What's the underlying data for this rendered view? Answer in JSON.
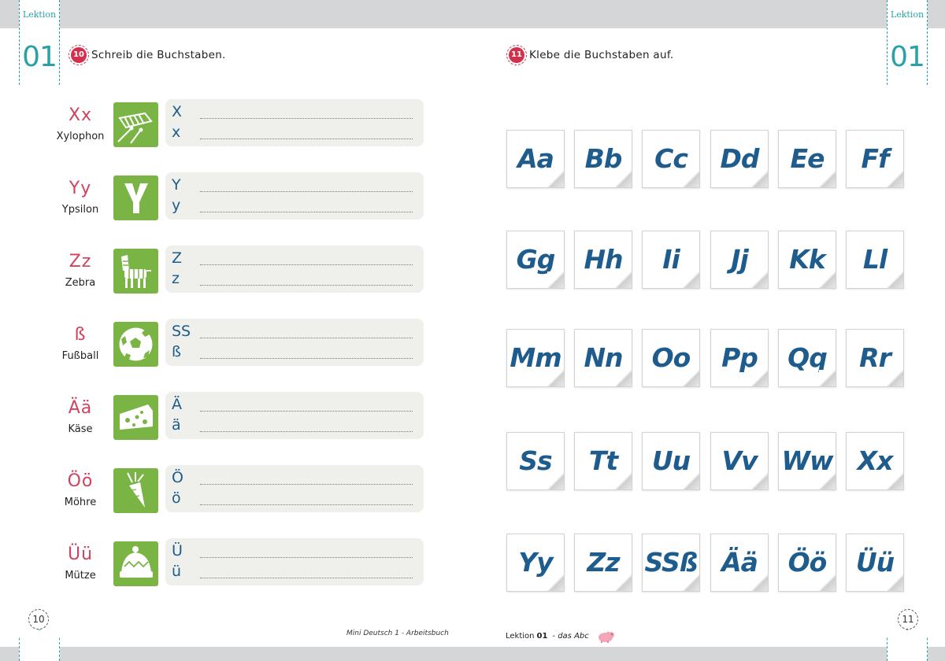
{
  "lesson_tab": {
    "label": "Lektion",
    "number": "01"
  },
  "exercise_left": {
    "number": "10",
    "text": "Schreib die Buchstaben."
  },
  "exercise_right": {
    "number": "11",
    "text": "Klebe die Buchstaben auf."
  },
  "letter_rows": [
    {
      "letter": "Xx",
      "word": "Xylophon",
      "upper": "X",
      "lower": "x",
      "icon": "xylophone-icon"
    },
    {
      "letter": "Yy",
      "word": "Ypsilon",
      "upper": "Y",
      "lower": "y",
      "icon": "y-letter-icon"
    },
    {
      "letter": "Zz",
      "word": "Zebra",
      "upper": "Z",
      "lower": "z",
      "icon": "zebra-icon"
    },
    {
      "letter": "ß",
      "word": "Fußball",
      "upper": "SS",
      "lower": "ß",
      "icon": "soccer-ball-icon"
    },
    {
      "letter": "Ää",
      "word": "Käse",
      "upper": "Ä",
      "lower": "ä",
      "icon": "cheese-icon"
    },
    {
      "letter": "Öö",
      "word": "Möhre",
      "upper": "Ö",
      "lower": "ö",
      "icon": "carrot-icon"
    },
    {
      "letter": "Üü",
      "word": "Mütze",
      "upper": "Ü",
      "lower": "ü",
      "icon": "hat-icon"
    }
  ],
  "sticker_cards": [
    "Aa",
    "Bb",
    "Cc",
    "Dd",
    "Ee",
    "Ff",
    "Gg",
    "Hh",
    "Ii",
    "Jj",
    "Kk",
    "Ll",
    "Mm",
    "Nn",
    "Oo",
    "Pp",
    "Qq",
    "Rr",
    "Ss",
    "Tt",
    "Uu",
    "Vv",
    "Ww",
    "Xx",
    "Yy",
    "Zz",
    "SSß",
    "Ää",
    "Öö",
    "Üü"
  ],
  "page_numbers": {
    "left": "10",
    "right": "11"
  },
  "footer": {
    "left": "Mini Deutsch 1 - Arbeitsbuch",
    "right_prefix": "Lektion",
    "right_number": "01",
    "right_title": "- das Abc"
  },
  "colors": {
    "teal": "#2aa1a6",
    "pink": "#d1425f",
    "blue": "#1e5c8e",
    "green": "#7ab445",
    "badge": "#d3304d"
  }
}
